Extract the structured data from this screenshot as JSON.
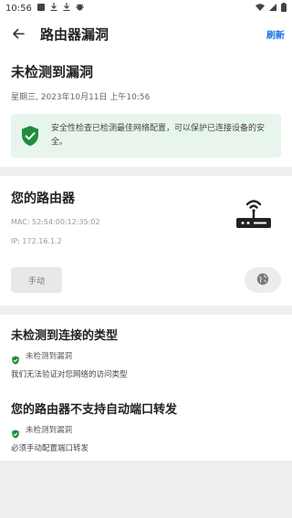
{
  "statusbar": {
    "time": "10:56"
  },
  "appbar": {
    "title": "路由器漏洞",
    "refresh": "刷新"
  },
  "summary": {
    "title": "未检测到漏洞",
    "date": "星期三, 2023年10月11日 上午10:56",
    "notice": "安全性检查已检测最佳网络配置，可以保护已连接设备的安全。"
  },
  "router": {
    "title": "您的路由器",
    "mac": "MAC: 52:54:00:12:35:02",
    "ip": "IP: 172.16.1.2",
    "manual_label": "手动"
  },
  "issues": [
    {
      "title": "未检测到连接的类型",
      "status": "未检测到漏洞",
      "desc": "我们无法验证对您网络的访问类型"
    },
    {
      "title": "您的路由器不支持自动端口转发",
      "status": "未检测到漏洞",
      "desc": "必须手动配置端口转发"
    }
  ],
  "colors": {
    "accent": "#1a73e8",
    "success": "#1e8e3e",
    "notice_bg": "#e8f5ec"
  }
}
